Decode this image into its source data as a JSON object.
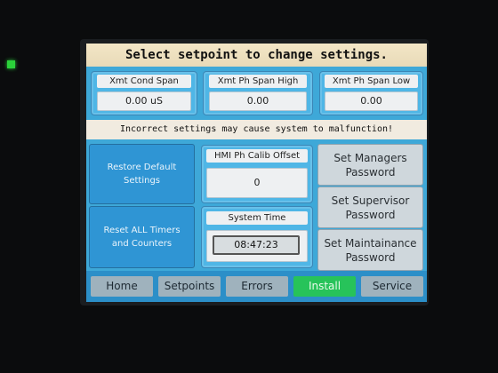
{
  "header": {
    "title": "Select setpoint to change settings."
  },
  "setpoints": [
    {
      "label": "Xmt Cond Span",
      "value": "0.00 uS"
    },
    {
      "label": "Xmt Ph Span High",
      "value": "0.00"
    },
    {
      "label": "Xmt Ph Span Low",
      "value": "0.00"
    }
  ],
  "warning": "Incorrect settings may cause system to malfunction!",
  "left_buttons": {
    "restore": "Restore Default Settings",
    "reset": "Reset ALL Timers and Counters"
  },
  "hmi_offset": {
    "label": "HMI Ph Calib Offset",
    "value": "0"
  },
  "system_time": {
    "label": "System Time",
    "value": "08:47:23"
  },
  "right_buttons": {
    "managers": "Set Managers Password",
    "supervisor": "Set Supervisor Password",
    "maintenance": "Set Maintainance Password"
  },
  "nav": {
    "home": "Home",
    "setpoints": "Setpoints",
    "errors": "Errors",
    "install": "Install",
    "service": "Service",
    "active": "Install"
  },
  "colors": {
    "screen_bg": "#3ea8d8",
    "active_tab": "#27c35a",
    "status_led": "#2bd23a"
  }
}
